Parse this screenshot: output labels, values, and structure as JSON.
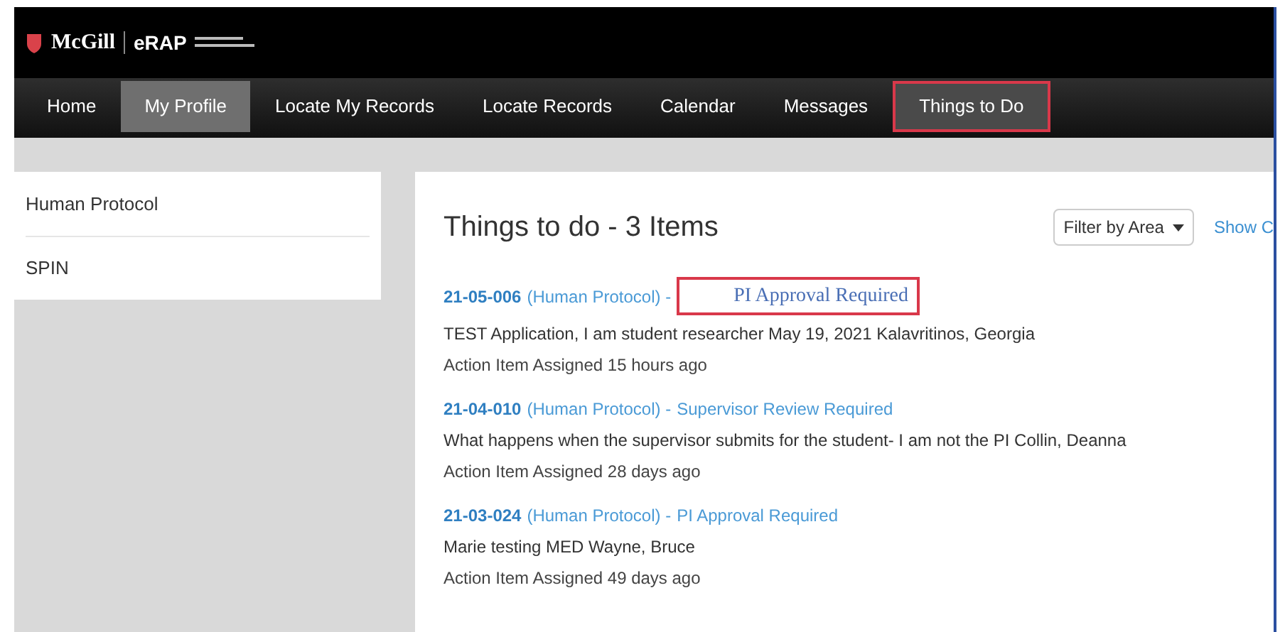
{
  "header": {
    "brand": "McGill",
    "product": "eRAP"
  },
  "nav": [
    {
      "label": "Home",
      "selected": false,
      "highlighted": false
    },
    {
      "label": "My Profile",
      "selected": true,
      "highlighted": false
    },
    {
      "label": "Locate My Records",
      "selected": false,
      "highlighted": false
    },
    {
      "label": "Locate Records",
      "selected": false,
      "highlighted": false
    },
    {
      "label": "Calendar",
      "selected": false,
      "highlighted": false
    },
    {
      "label": "Messages",
      "selected": false,
      "highlighted": false
    },
    {
      "label": "Things to Do",
      "selected": false,
      "highlighted": true
    }
  ],
  "sidebar": {
    "items": [
      "Human Protocol",
      "SPIN"
    ]
  },
  "main": {
    "title": "Things to do - 3 Items",
    "filter": "Filter by Area",
    "show_link": "Show C",
    "items": [
      {
        "id": "21-05-006",
        "type": "(Human Protocol) -",
        "status": "PI Approval Required",
        "highlighted": true,
        "description": "TEST Application, I am student researcher May 19, 2021 Kalavritinos, Georgia",
        "assigned": "Action Item Assigned 15 hours ago"
      },
      {
        "id": "21-04-010",
        "type": "(Human Protocol) -",
        "status": "Supervisor Review Required",
        "highlighted": false,
        "description": "What happens when the supervisor submits for the student- I am not the PI Collin, Deanna",
        "assigned": "Action Item Assigned 28 days ago"
      },
      {
        "id": "21-03-024",
        "type": "(Human Protocol) -",
        "status": "PI Approval Required",
        "highlighted": false,
        "description": "Marie testing MED Wayne, Bruce",
        "assigned": "Action Item Assigned 49 days ago"
      }
    ]
  }
}
